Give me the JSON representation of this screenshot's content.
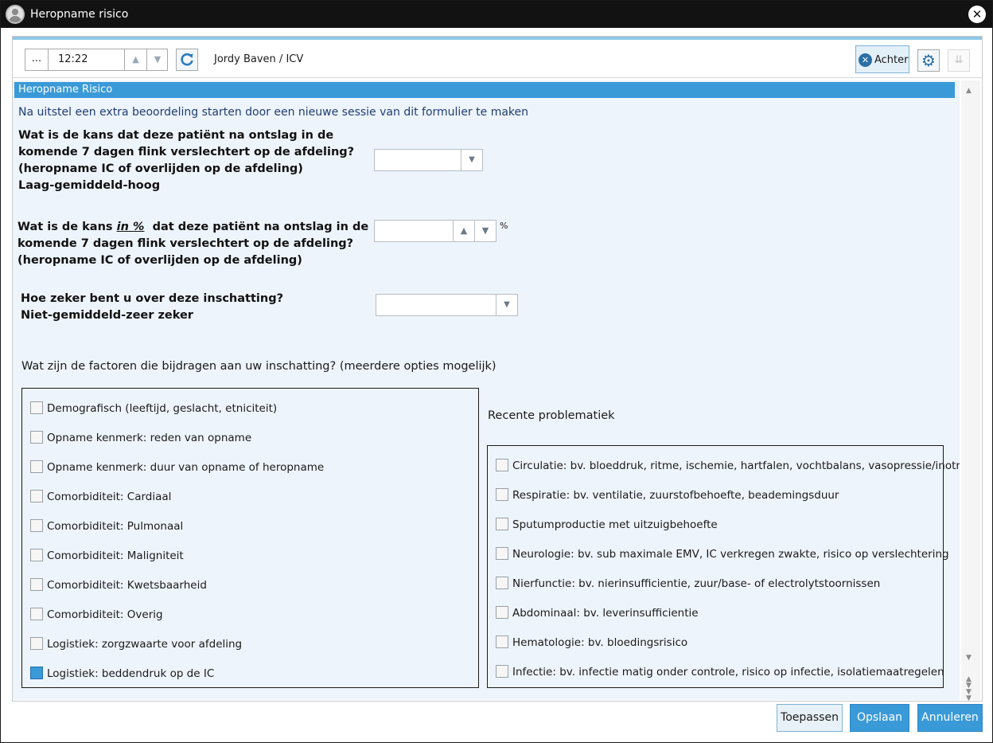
{
  "window": {
    "title": "Heropname risico",
    "close_label": "✕"
  },
  "toolbar": {
    "dots_label": "...",
    "time_value": "12:22",
    "patient": "Jordy Baven / ICV",
    "back_label": "Achter"
  },
  "section": {
    "header": "Heropname Risico",
    "info": "Na uitstel een extra beoordeling starten door een nieuwe sessie van dit formulier te maken"
  },
  "questions": {
    "q1_lines": [
      "Wat is de kans dat deze patiënt na ontslag in de",
      "komende 7 dagen flink verslechtert op de afdeling?",
      "(heropname IC of overlijden op de afdeling)",
      "Laag-gemiddeld-hoog"
    ],
    "q2_prefix": "Wat is de kans ",
    "q2_inpct": "in %",
    "q2_suffix": "  dat deze patiënt na ontslag in de",
    "q2_lines": [
      "komende 7 dagen flink verslechtert op de afdeling?",
      "(heropname IC of overlijden op de afdeling)"
    ],
    "q2_unit": "%",
    "q3_lines": [
      "Hoe zeker bent u over deze inschatting?",
      "Niet-gemiddeld-zeer zeker"
    ],
    "factors": "Wat zijn de factoren die bijdragen aan uw inschatting? (meerdere opties mogelijk)"
  },
  "factors_left": [
    "Demografisch (leeftijd, geslacht, etniciteit)",
    "Opname kenmerk: reden van opname",
    "Opname kenmerk: duur van opname of heropname",
    "Comorbiditeit: Cardiaal",
    "Comorbiditeit: Pulmonaal",
    "Comorbiditeit: Maligniteit",
    "Comorbiditeit: Kwetsbaarheid",
    "Comorbiditeit: Overig",
    "Logistiek: zorgzwaarte voor afdeling",
    "Logistiek: beddendruk op de IC"
  ],
  "recent": {
    "title": "Recente problematiek",
    "items": [
      "Circulatie: bv. bloeddruk, ritme, ischemie, hartfalen, vochtbalans, vasopressie/inotropie",
      "Respiratie: bv. ventilatie, zuurstofbehoefte, beademingsduur",
      "Sputumproductie met uitzuigbehoefte",
      "Neurologie: bv. sub maximale EMV, IC verkregen zwakte, risico op verslechtering",
      "Nierfunctie: bv. nierinsufficientie, zuur/base- of electrolytstoornissen",
      "Abdominaal: bv. leverinsufficientie",
      "Hematologie: bv. bloedingsrisico",
      "Infectie: bv. infectie matig onder controle, risico op infectie, isolatiemaatregelen"
    ]
  },
  "footer": {
    "apply_label": "Toepassen",
    "save_label": "Opslaan",
    "cancel_label": "Annuleren"
  },
  "colors": {
    "accent": "#3a9ad8",
    "panel_bg": "#eef4fb",
    "titlebar": "#121212"
  },
  "icons": [
    "user-avatar-icon",
    "close-icon",
    "refresh-icon",
    "cancel-circle-icon",
    "gear-icon",
    "collapse-icon"
  ]
}
